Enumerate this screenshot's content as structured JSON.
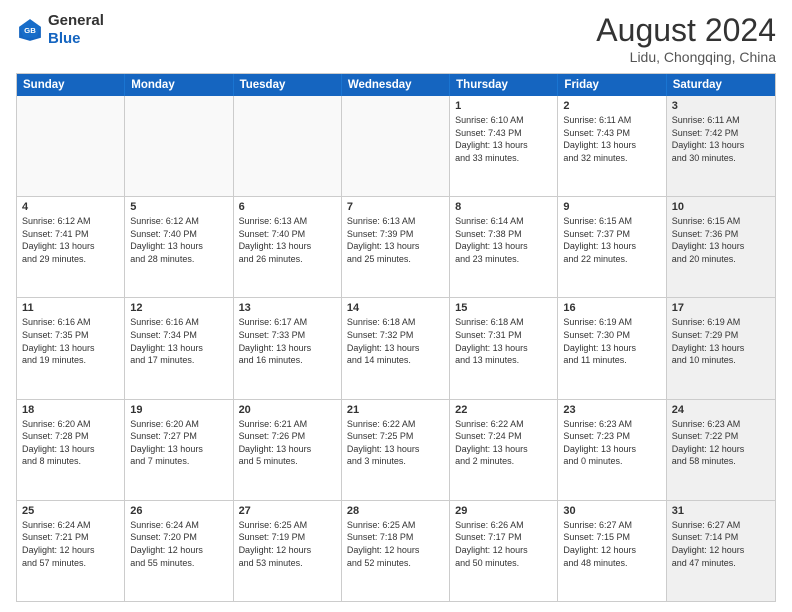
{
  "header": {
    "logo_general": "General",
    "logo_blue": "Blue",
    "month_year": "August 2024",
    "location": "Lidu, Chongqing, China"
  },
  "days_of_week": [
    "Sunday",
    "Monday",
    "Tuesday",
    "Wednesday",
    "Thursday",
    "Friday",
    "Saturday"
  ],
  "weeks": [
    [
      {
        "day": "",
        "text": "",
        "empty": true
      },
      {
        "day": "",
        "text": "",
        "empty": true
      },
      {
        "day": "",
        "text": "",
        "empty": true
      },
      {
        "day": "",
        "text": "",
        "empty": true
      },
      {
        "day": "1",
        "text": "Sunrise: 6:10 AM\nSunset: 7:43 PM\nDaylight: 13 hours\nand 33 minutes.",
        "empty": false
      },
      {
        "day": "2",
        "text": "Sunrise: 6:11 AM\nSunset: 7:43 PM\nDaylight: 13 hours\nand 32 minutes.",
        "empty": false
      },
      {
        "day": "3",
        "text": "Sunrise: 6:11 AM\nSunset: 7:42 PM\nDaylight: 13 hours\nand 30 minutes.",
        "empty": false,
        "shaded": true
      }
    ],
    [
      {
        "day": "4",
        "text": "Sunrise: 6:12 AM\nSunset: 7:41 PM\nDaylight: 13 hours\nand 29 minutes.",
        "empty": false
      },
      {
        "day": "5",
        "text": "Sunrise: 6:12 AM\nSunset: 7:40 PM\nDaylight: 13 hours\nand 28 minutes.",
        "empty": false
      },
      {
        "day": "6",
        "text": "Sunrise: 6:13 AM\nSunset: 7:40 PM\nDaylight: 13 hours\nand 26 minutes.",
        "empty": false
      },
      {
        "day": "7",
        "text": "Sunrise: 6:13 AM\nSunset: 7:39 PM\nDaylight: 13 hours\nand 25 minutes.",
        "empty": false
      },
      {
        "day": "8",
        "text": "Sunrise: 6:14 AM\nSunset: 7:38 PM\nDaylight: 13 hours\nand 23 minutes.",
        "empty": false
      },
      {
        "day": "9",
        "text": "Sunrise: 6:15 AM\nSunset: 7:37 PM\nDaylight: 13 hours\nand 22 minutes.",
        "empty": false
      },
      {
        "day": "10",
        "text": "Sunrise: 6:15 AM\nSunset: 7:36 PM\nDaylight: 13 hours\nand 20 minutes.",
        "empty": false,
        "shaded": true
      }
    ],
    [
      {
        "day": "11",
        "text": "Sunrise: 6:16 AM\nSunset: 7:35 PM\nDaylight: 13 hours\nand 19 minutes.",
        "empty": false
      },
      {
        "day": "12",
        "text": "Sunrise: 6:16 AM\nSunset: 7:34 PM\nDaylight: 13 hours\nand 17 minutes.",
        "empty": false
      },
      {
        "day": "13",
        "text": "Sunrise: 6:17 AM\nSunset: 7:33 PM\nDaylight: 13 hours\nand 16 minutes.",
        "empty": false
      },
      {
        "day": "14",
        "text": "Sunrise: 6:18 AM\nSunset: 7:32 PM\nDaylight: 13 hours\nand 14 minutes.",
        "empty": false
      },
      {
        "day": "15",
        "text": "Sunrise: 6:18 AM\nSunset: 7:31 PM\nDaylight: 13 hours\nand 13 minutes.",
        "empty": false
      },
      {
        "day": "16",
        "text": "Sunrise: 6:19 AM\nSunset: 7:30 PM\nDaylight: 13 hours\nand 11 minutes.",
        "empty": false
      },
      {
        "day": "17",
        "text": "Sunrise: 6:19 AM\nSunset: 7:29 PM\nDaylight: 13 hours\nand 10 minutes.",
        "empty": false,
        "shaded": true
      }
    ],
    [
      {
        "day": "18",
        "text": "Sunrise: 6:20 AM\nSunset: 7:28 PM\nDaylight: 13 hours\nand 8 minutes.",
        "empty": false
      },
      {
        "day": "19",
        "text": "Sunrise: 6:20 AM\nSunset: 7:27 PM\nDaylight: 13 hours\nand 7 minutes.",
        "empty": false
      },
      {
        "day": "20",
        "text": "Sunrise: 6:21 AM\nSunset: 7:26 PM\nDaylight: 13 hours\nand 5 minutes.",
        "empty": false
      },
      {
        "day": "21",
        "text": "Sunrise: 6:22 AM\nSunset: 7:25 PM\nDaylight: 13 hours\nand 3 minutes.",
        "empty": false
      },
      {
        "day": "22",
        "text": "Sunrise: 6:22 AM\nSunset: 7:24 PM\nDaylight: 13 hours\nand 2 minutes.",
        "empty": false
      },
      {
        "day": "23",
        "text": "Sunrise: 6:23 AM\nSunset: 7:23 PM\nDaylight: 13 hours\nand 0 minutes.",
        "empty": false
      },
      {
        "day": "24",
        "text": "Sunrise: 6:23 AM\nSunset: 7:22 PM\nDaylight: 12 hours\nand 58 minutes.",
        "empty": false,
        "shaded": true
      }
    ],
    [
      {
        "day": "25",
        "text": "Sunrise: 6:24 AM\nSunset: 7:21 PM\nDaylight: 12 hours\nand 57 minutes.",
        "empty": false
      },
      {
        "day": "26",
        "text": "Sunrise: 6:24 AM\nSunset: 7:20 PM\nDaylight: 12 hours\nand 55 minutes.",
        "empty": false
      },
      {
        "day": "27",
        "text": "Sunrise: 6:25 AM\nSunset: 7:19 PM\nDaylight: 12 hours\nand 53 minutes.",
        "empty": false
      },
      {
        "day": "28",
        "text": "Sunrise: 6:25 AM\nSunset: 7:18 PM\nDaylight: 12 hours\nand 52 minutes.",
        "empty": false
      },
      {
        "day": "29",
        "text": "Sunrise: 6:26 AM\nSunset: 7:17 PM\nDaylight: 12 hours\nand 50 minutes.",
        "empty": false
      },
      {
        "day": "30",
        "text": "Sunrise: 6:27 AM\nSunset: 7:15 PM\nDaylight: 12 hours\nand 48 minutes.",
        "empty": false
      },
      {
        "day": "31",
        "text": "Sunrise: 6:27 AM\nSunset: 7:14 PM\nDaylight: 12 hours\nand 47 minutes.",
        "empty": false,
        "shaded": true
      }
    ]
  ]
}
